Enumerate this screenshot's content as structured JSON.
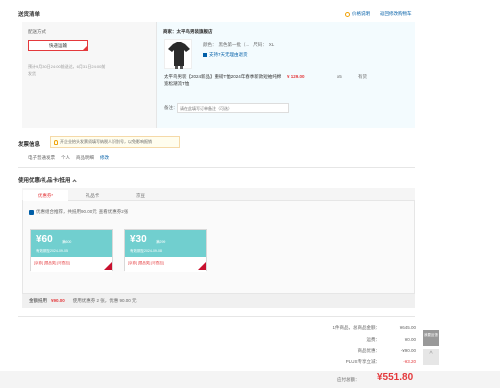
{
  "header": {
    "title": "送货清单",
    "price_note": "价格说明",
    "back_to_cart": "返回修改购物车"
  },
  "delivery": {
    "label": "配送方式",
    "selected": "快递运输",
    "shipping_time": "预计9月30日24:00前送达，6月31日24:00前发货"
  },
  "shop": {
    "name": "商家：太平鸟男装旗舰店",
    "product": {
      "title": "太平鸟男装【2024新品】重磅T恤2024年春季新款短袖纯棉宽松潮流T恤",
      "color_label": "颜色：",
      "color": "黑色第一批（...",
      "size_label": "尺码：",
      "size": "XL",
      "service": "支持7天无理由退货",
      "price": "¥ 129.00",
      "quantity": "x5",
      "stock": "有货"
    },
    "remark_label": "备注：",
    "remark_placeholder": "请在此填写订单备注（可选）"
  },
  "invoice": {
    "title": "发票信息",
    "notice": "开企业抬头发票须填写纳税人识别号，以免影响报销",
    "type": "电子普通发票",
    "holder": "个人",
    "content": "商品明细",
    "edit": "修改"
  },
  "discounts": {
    "title": "使用优惠/礼品卡/抵用",
    "tabs": [
      "优惠券",
      "礼品卡",
      "京豆"
    ],
    "auto_select": "优惠组合推荐，共抵用90.00元",
    "auto_select_suffix": "查看优惠券2张",
    "coupons": [
      {
        "amount": "¥60",
        "condition": "满600",
        "date": "有效期至2024-09-05",
        "tags": "[京券] [限品类] [可叠加]"
      },
      {
        "amount": "¥30",
        "condition": "满299",
        "date": "有效期至2024-09-08",
        "tags": "[京券] [限品类] [可叠加]"
      }
    ],
    "total_label": "金额抵用",
    "total_value": "¥90.00",
    "total_note": "使用优惠券 2 张，优惠 90.00 元"
  },
  "summary": {
    "rows": [
      {
        "label": "1件商品，总商品金额：",
        "value": "¥645.00"
      },
      {
        "label": "运费：",
        "value": "¥0.00"
      },
      {
        "label": "商品优惠：",
        "value": "-¥90.00"
      },
      {
        "label": "PLUS专享立减：",
        "value": "-¥3.20"
      }
    ],
    "payable_label": "应付总额：",
    "payable_value": "¥551.80"
  },
  "sidebar": {
    "feedback": "我要反馈",
    "top": "^"
  }
}
